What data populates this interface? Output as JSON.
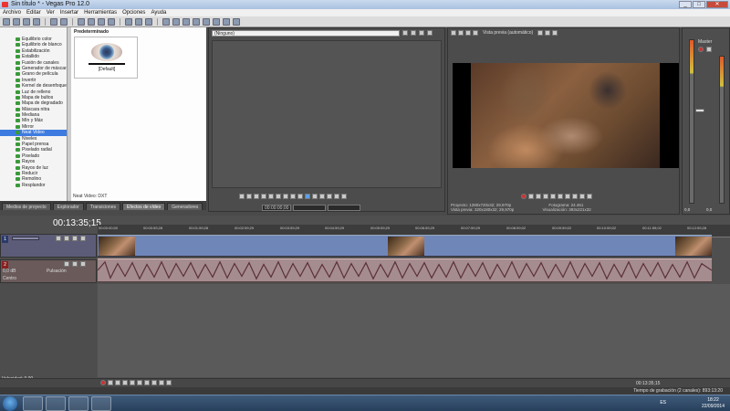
{
  "window": {
    "title": "Sin título * - Vegas Pro 12.0",
    "min": "_",
    "max": "□",
    "close": "✕"
  },
  "menu": [
    "Archivo",
    "Editar",
    "Ver",
    "Insertar",
    "Herramientas",
    "Opciones",
    "Ayuda"
  ],
  "effects_tree": {
    "items": [
      "Equilibrio color",
      "Equilibrio de blanco",
      "Estabilización",
      "Estallido",
      "Fusión de canales",
      "Generador de máscara",
      "Grano de película",
      "Invertir",
      "Kernel de desenfoque",
      "Luz de relleno",
      "Mapa de bultos",
      "Mapa de degradado",
      "Máscara nitra",
      "Mediana",
      "Mín y Máx",
      "Mirror",
      "Neat Video",
      "Niveles",
      "Papel prensa",
      "Pixelado radial",
      "Pixelado",
      "Rayos",
      "Rayos de luz",
      "Reducir",
      "Remolino",
      "Resplandor"
    ],
    "selected": "Neat Video"
  },
  "presets": {
    "header": "Predeterminado",
    "item_label": "[Default]",
    "status": "Neat Video: DXT"
  },
  "left_tabs": [
    "Medios de proyecto",
    "Explorador",
    "Transiciones",
    "Efectos de vídeo",
    "Generadores"
  ],
  "active_left_tab": "Efectos de vídeo",
  "trimmer": {
    "combo_value": "(Ninguno)",
    "timecode": "00:00:00;00"
  },
  "preview": {
    "mode": "Vista previa (automático)",
    "info": {
      "proyecto_label": "Proyecto:",
      "proyecto_value": "1280x720x32; 29,970p",
      "vista_previa_label": "Vista previa:",
      "vista_previa_value": "320x180x32; 29,970p",
      "fotograma_label": "Fotograma:",
      "fotograma_value": "24.461",
      "visualizacion_label": "Visualización:",
      "visualizacion_value": "393x221x32"
    }
  },
  "mixer": {
    "title": "Master",
    "level": "0,0",
    "level2": "0,0"
  },
  "timeline": {
    "current_time": "00:13:35;15",
    "ruler": [
      "00:00:00;00",
      "00:00:59;28",
      "00:01:59;28",
      "00:02:59;29",
      "00:03:59;29",
      "00:04:59;29",
      "00:05:59;29",
      "00:06:59;29",
      "00:07:59;29",
      "00:08:59;02",
      "00:09:59;02",
      "00:10:59;02",
      "00:11:59;02",
      "00:12:59;28"
    ],
    "audio_track": {
      "volume": "0,0 dB",
      "mode": "Pulsación",
      "pan": "Centro"
    },
    "velocity": "Velocidad: 0,00",
    "transport_timecode": "00:13:35;15"
  },
  "status": {
    "record_time": "Tiempo de grabación (2 canales): 893:13:20"
  },
  "taskbar": {
    "lang": "ES",
    "time": "18:22",
    "date": "22/09/2014"
  },
  "colors": {
    "accent": "#3d7be0",
    "video_track": "#6f86b8",
    "audio_track": "#a58c8e"
  }
}
